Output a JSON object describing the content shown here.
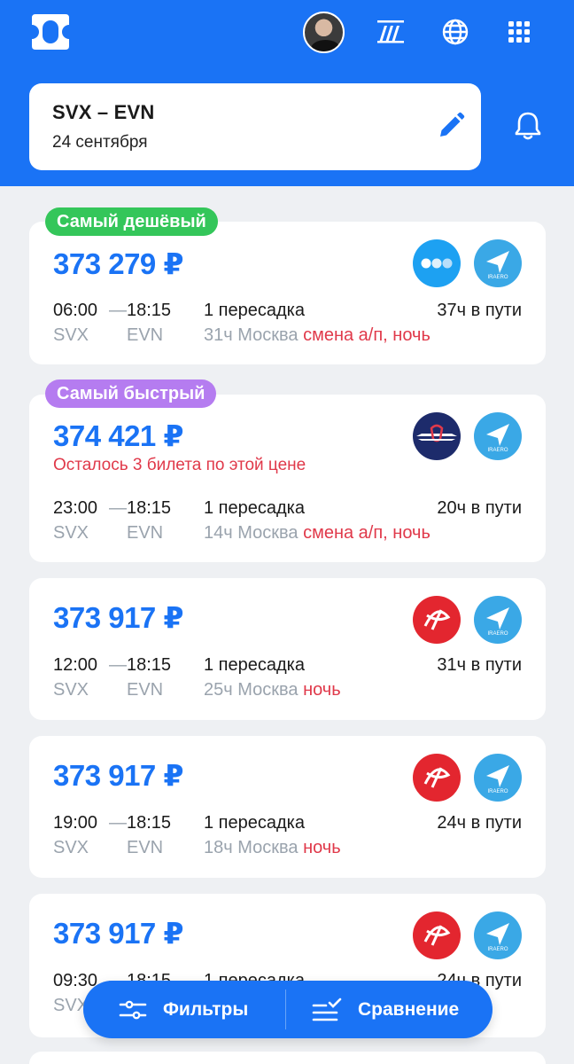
{
  "header": {
    "route": "SVX – EVN",
    "date": "24 сентября"
  },
  "colors": {
    "accent": "#1a73f5",
    "cheapest_badge": "#34c65a",
    "fastest_badge": "#b57cf0",
    "warning": "#e0394a",
    "muted": "#9aa3ad"
  },
  "offers": [
    {
      "badge": "Самый дешёвый",
      "price": "373 279 ₽",
      "warning": "",
      "dep_time": "06:00",
      "arr_time": "18:15",
      "dep_code": "SVX",
      "arr_code": "EVN",
      "stops": "1 пересадка",
      "duration": "37ч в пути",
      "layover": "31ч Москва",
      "alert": "смена а/п, ночь",
      "airlines": [
        "dots-airline-logo",
        "iraero-airlines-logo"
      ]
    },
    {
      "badge": "Самый быстрый",
      "price": "374 421 ₽",
      "warning": "Осталось 3 билета по этой цене",
      "dep_time": "23:00",
      "arr_time": "18:15",
      "dep_code": "SVX",
      "arr_code": "EVN",
      "stops": "1 пересадка",
      "duration": "20ч в пути",
      "layover": "14ч Москва",
      "alert": "смена а/п, ночь",
      "airlines": [
        "aeroflot-logo",
        "iraero-airlines-logo"
      ]
    },
    {
      "badge": "",
      "price": "373 917 ₽",
      "warning": "",
      "dep_time": "12:00",
      "arr_time": "18:15",
      "dep_code": "SVX",
      "arr_code": "EVN",
      "stops": "1 пересадка",
      "duration": "31ч в пути",
      "layover": "25ч Москва",
      "alert": "ночь",
      "airlines": [
        "red-airline-logo",
        "iraero-airlines-logo"
      ]
    },
    {
      "badge": "",
      "price": "373 917 ₽",
      "warning": "",
      "dep_time": "19:00",
      "arr_time": "18:15",
      "dep_code": "SVX",
      "arr_code": "EVN",
      "stops": "1 пересадка",
      "duration": "24ч в пути",
      "layover": "18ч Москва",
      "alert": "ночь",
      "airlines": [
        "red-airline-logo",
        "iraero-airlines-logo"
      ]
    },
    {
      "badge": "",
      "price": "373 917 ₽",
      "warning": "",
      "dep_time": "09:30",
      "arr_time": "18:15",
      "dep_code": "SVX",
      "arr_code": "",
      "stops": "1 пересадка",
      "duration": "24ч в пути",
      "layover": "",
      "alert": "",
      "airlines": [
        "red-airline-logo",
        "iraero-airlines-logo"
      ]
    }
  ],
  "fab": {
    "filters_label": "Фильтры",
    "compare_label": "Сравнение"
  }
}
